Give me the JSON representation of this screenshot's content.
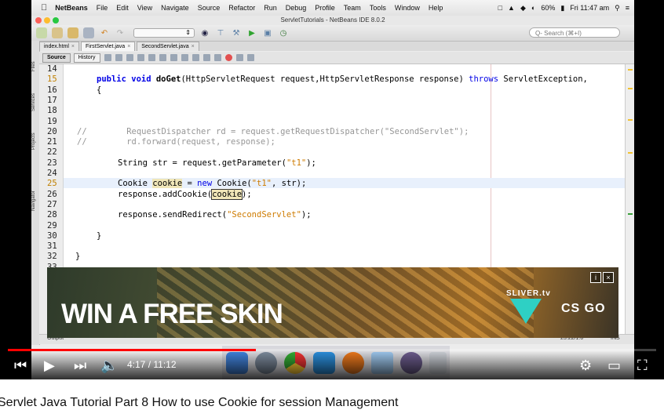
{
  "menubar": {
    "apple": "",
    "app": "NetBeans",
    "items": [
      "File",
      "Edit",
      "View",
      "Navigate",
      "Source",
      "Refactor",
      "Run",
      "Debug",
      "Profile",
      "Team",
      "Tools",
      "Window",
      "Help"
    ],
    "battery": "60%",
    "clock": "Fri 11:47 am"
  },
  "window": {
    "title": "ServletTutorials - NetBeans IDE 8.0.2"
  },
  "toolbar": {
    "search_placeholder": "Q- Search (⌘+I)"
  },
  "tabs": [
    {
      "label": "index.html"
    },
    {
      "label": "FirstServlet.java"
    },
    {
      "label": "SecondServlet.java"
    }
  ],
  "editor_toolbar": {
    "source": "Source",
    "history": "History"
  },
  "sidebar": {
    "files": "Files",
    "services": "Services",
    "projects": "Projects",
    "navigator": "Navigator"
  },
  "line_numbers": [
    "14",
    "15",
    "16",
    "17",
    "18",
    "19",
    "20",
    "21",
    "22",
    "23",
    "24",
    "25",
    "26",
    "27",
    "28",
    "29",
    "30",
    "31",
    "32",
    "33"
  ],
  "code": {
    "l15_a": "public void ",
    "l15_b": "doGet",
    "l15_c": "(HttpServletRequest request,HttpServletResponse response) ",
    "l15_d": "throws",
    "l15_e": " ServletException,",
    "l16": "{",
    "l20_comment": "//        RequestDispatcher rd = request.getRequestDispatcher(\"SecondServlet\");",
    "l21_comment": "//        rd.forward(request, response);",
    "l23_a": "String str = request.getParameter(",
    "l23_b": "\"t1\"",
    "l23_c": ");",
    "l25_a": "Cookie ",
    "l25_b": "cookie",
    "l25_c": " = ",
    "l25_d": "new",
    "l25_e": " Cookie(",
    "l25_f": "\"t1\"",
    "l25_g": ", str);",
    "l26_a": "response.addCookie(",
    "l26_b": "cookie",
    "l26_c": ");",
    "l28_a": "response.sendRedirect(",
    "l28_b": "\"SecondServlet\"",
    "l28_c": ");",
    "l30": "}",
    "l32": "}"
  },
  "status": {
    "output": "Output",
    "position": "25:22/1:6",
    "mode": "INS"
  },
  "ad": {
    "headline": "WIN A FREE SKIN",
    "sliver": "SLIVER.tv",
    "csgo": "CS GO"
  },
  "player": {
    "time": "4:17 / 11:12",
    "progress_fraction": 0.382
  },
  "video_title": "Servlet Java Tutorial Part 8 How to use Cookie for session Management",
  "colors": {
    "progress": "#ff0000",
    "keyword": "#0000e6",
    "string": "#ce7b00",
    "comment": "#969696"
  }
}
